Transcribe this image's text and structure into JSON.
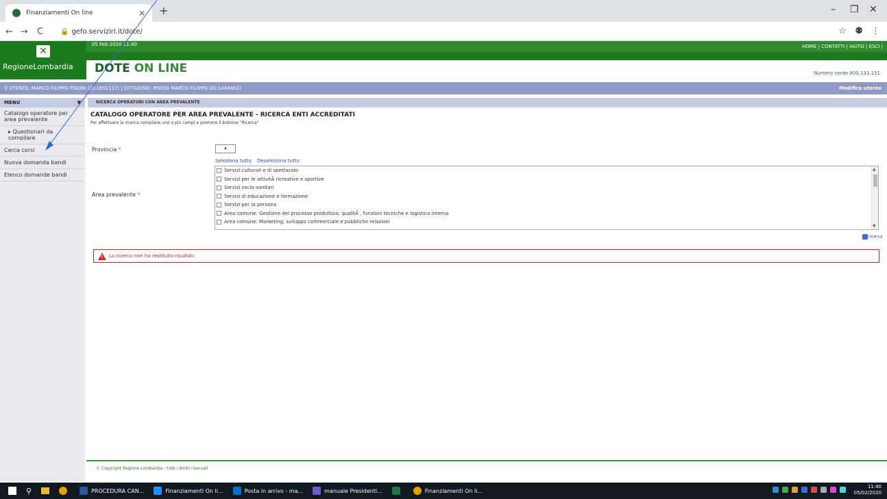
{
  "browser": {
    "tab_title": "Finanziamenti On line",
    "tab_close": "×",
    "new_tab": "+",
    "url": "gefo.servizirl.it/dote/",
    "win_min": "–",
    "win_max": "❐",
    "win_close": "✕",
    "back": "←",
    "forward": "→",
    "reload": "C",
    "star": "☆",
    "account": "⚉",
    "more": "⋮"
  },
  "header": {
    "datetime": "05 Feb 2020 11:40",
    "links": "HOME | CONTATTI | AIUTO | ESCI |",
    "logo_text": "RegioneLombardia",
    "app_title_part1": "DOTE",
    "app_title_part2": "ON LINE",
    "numero_verde": "Numero verde 800.131.151"
  },
  "userbar": {
    "user_info": "UTENTE: MARCO FILIPPO PISONI (ID:1651117) | CITTADINO: PISONI MARCO FILIPPO (ID:1448462)",
    "modifica_utente": "Modifica utente"
  },
  "sidebar": {
    "menu_label": "MENU",
    "menu_arrow": "▼",
    "items": [
      {
        "label": "Catalogo operatore per area prevalente"
      },
      {
        "label": "▸ Questionari da compilare"
      },
      {
        "label": "Cerca corsi"
      },
      {
        "label": "Nuova domanda bandi"
      },
      {
        "label": "Elenco domande bandi"
      }
    ]
  },
  "main": {
    "breadcrumb": "RICERCA OPERATORI CON AREA PREVALENTE",
    "title": "CATALOGO OPERATORE PER AREA PREVALENTE - RICERCA ENTI ACCREDITATI",
    "intro": "Per effettuare la ricerca compilare uno o più campi e premere il bottone \"Ricerca\"",
    "provincia_label": "Provincia",
    "required_mark": "*",
    "provincia_value": "▾",
    "select_all": "Seleziona tutto",
    "deselect_all": "Deseleziona tutto",
    "area_label": "Area prevalente",
    "areas": [
      "Servizi culturali e di spettacolo",
      "Servizi per le attivitÃ  ricreative e sportive",
      "Servizi socio-sanitari",
      "Servizi di educazione e formazione",
      "Servizi per la persona",
      "Area comune: Gestione del processo produttivo, qualitÃ , funzioni tecniche e logistica interna",
      "Area comune: Marketing, sviluppo commerciale e pubbliche relazioni"
    ],
    "ricerca_label": "ricerca",
    "alert_message": "La ricerca non ha restituito risultati.",
    "copyright": "© Copyright Regione Lombardia - tutti i diritti riservati"
  },
  "taskbar": {
    "items": [
      {
        "label": "PROCEDURA CAN...",
        "color": "#2b579a"
      },
      {
        "label": "Finanziamenti On li...",
        "color": "#1e90ff"
      },
      {
        "label": "Posta in arrivo - ma...",
        "color": "#0072c6"
      },
      {
        "label": "manuale Presidenti...",
        "color": "#6a5acd"
      },
      {
        "label": "",
        "color": "#217346"
      },
      {
        "label": "Finanziamenti On li...",
        "color": "#e8a000"
      }
    ],
    "time": "11:40",
    "date": "05/02/2020"
  }
}
